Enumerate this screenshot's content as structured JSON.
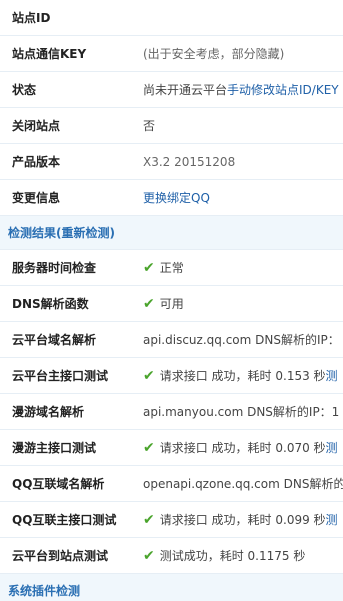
{
  "site_info": {
    "rows": [
      {
        "label": "站点ID",
        "value": ""
      },
      {
        "label": "站点通信KEY",
        "value": "(出于安全考虑，部分隐藏)"
      },
      {
        "label": "状态",
        "value": "尚未开通云平台 ",
        "link": "手动修改站点ID/KEY"
      },
      {
        "label": "关闭站点",
        "value": "否"
      },
      {
        "label": "产品版本",
        "value": "X3.2 20151208"
      },
      {
        "label": "变更信息",
        "link": "更换绑定QQ"
      }
    ]
  },
  "detect_section": {
    "title": "检测结果(",
    "recheck": "重新检测",
    "title_end": ")"
  },
  "detect_rows": [
    {
      "label": "服务器时间检查",
      "icon": "check-icon",
      "value": "正常"
    },
    {
      "label": "DNS解析函数",
      "icon": "check-icon",
      "value": "可用"
    },
    {
      "label": "云平台域名解析",
      "value": "api.discuz.qq.com DNS解析的IP："
    },
    {
      "label": "云平台主接口测试",
      "icon": "check-icon",
      "value": "请求接口 成功，耗时 0.153 秒 ",
      "link": "测"
    },
    {
      "label": "漫游域名解析",
      "value": "api.manyou.com DNS解析的IP：1"
    },
    {
      "label": "漫游主接口测试",
      "icon": "check-icon",
      "value": "请求接口 成功，耗时 0.070 秒 ",
      "link": "测"
    },
    {
      "label": "QQ互联域名解析",
      "value": "openapi.qzone.qq.com DNS解析的"
    },
    {
      "label": "QQ互联主接口测试",
      "icon": "check-icon",
      "value": "请求接口 成功，耗时 0.099 秒 ",
      "link": "测"
    },
    {
      "label": "云平台到站点测试",
      "icon": "check-icon",
      "value": "测试成功，耗时 0.1175 秒"
    }
  ],
  "plugin_section": {
    "title": "系统插件检测"
  },
  "colors": {
    "section_bg": "#f0f7fc",
    "section_text": "#2a6fb3",
    "link": "#1f60a8",
    "ok": "#4aa42c"
  }
}
